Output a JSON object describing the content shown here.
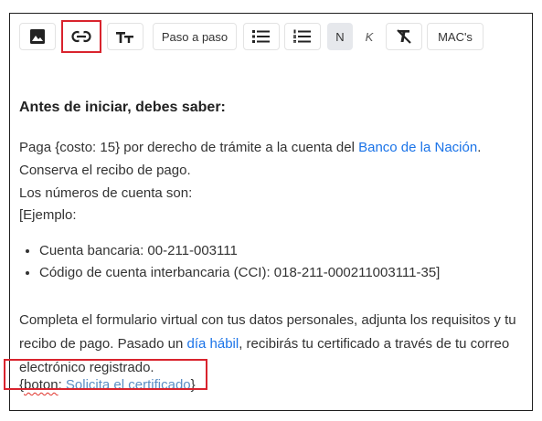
{
  "toolbar": {
    "image_icon": "image-icon",
    "link_icon": "link-icon",
    "text_size_icon": "text-size-icon",
    "paso_a_paso_label": "Paso a paso",
    "bullet_list_icon": "bulleted-list-icon",
    "numbered_list_icon": "numbered-list-icon",
    "bold_label": "N",
    "italic_label": "K",
    "clear_format_icon": "clear-format-icon",
    "macs_label": "MAC's"
  },
  "colors": {
    "highlight_border": "#d9232d",
    "link": "#1a73e8",
    "active_button_bg": "#e6e8ec"
  },
  "content": {
    "heading": "Antes de iniciar, debes saber:",
    "line1_before": "Paga {costo: 15} por derecho de trámite a la cuenta del ",
    "line1_link": "Banco de la Nación",
    "line1_after": ".",
    "line2": "Conserva el recibo de pago.",
    "line3": "Los números de cuenta son:",
    "line4": "[Ejemplo:",
    "bullets": [
      "Cuenta bancaria: 00-211-003111",
      "Código de cuenta interbancaria (CCI): 018-211-000211003111-35]"
    ],
    "para_before": "Completa el formulario virtual con tus datos personales, adjunta los requisitos y tu recibo de pago. Pasado un ",
    "para_link": "día hábil",
    "para_after": ", recibirás tu certificado a través de tu correo electrónico registrado.",
    "boton_open": "{",
    "boton_word": "boton",
    "boton_colon": ": ",
    "boton_link": "Solicita el certificado",
    "boton_close": "}"
  }
}
